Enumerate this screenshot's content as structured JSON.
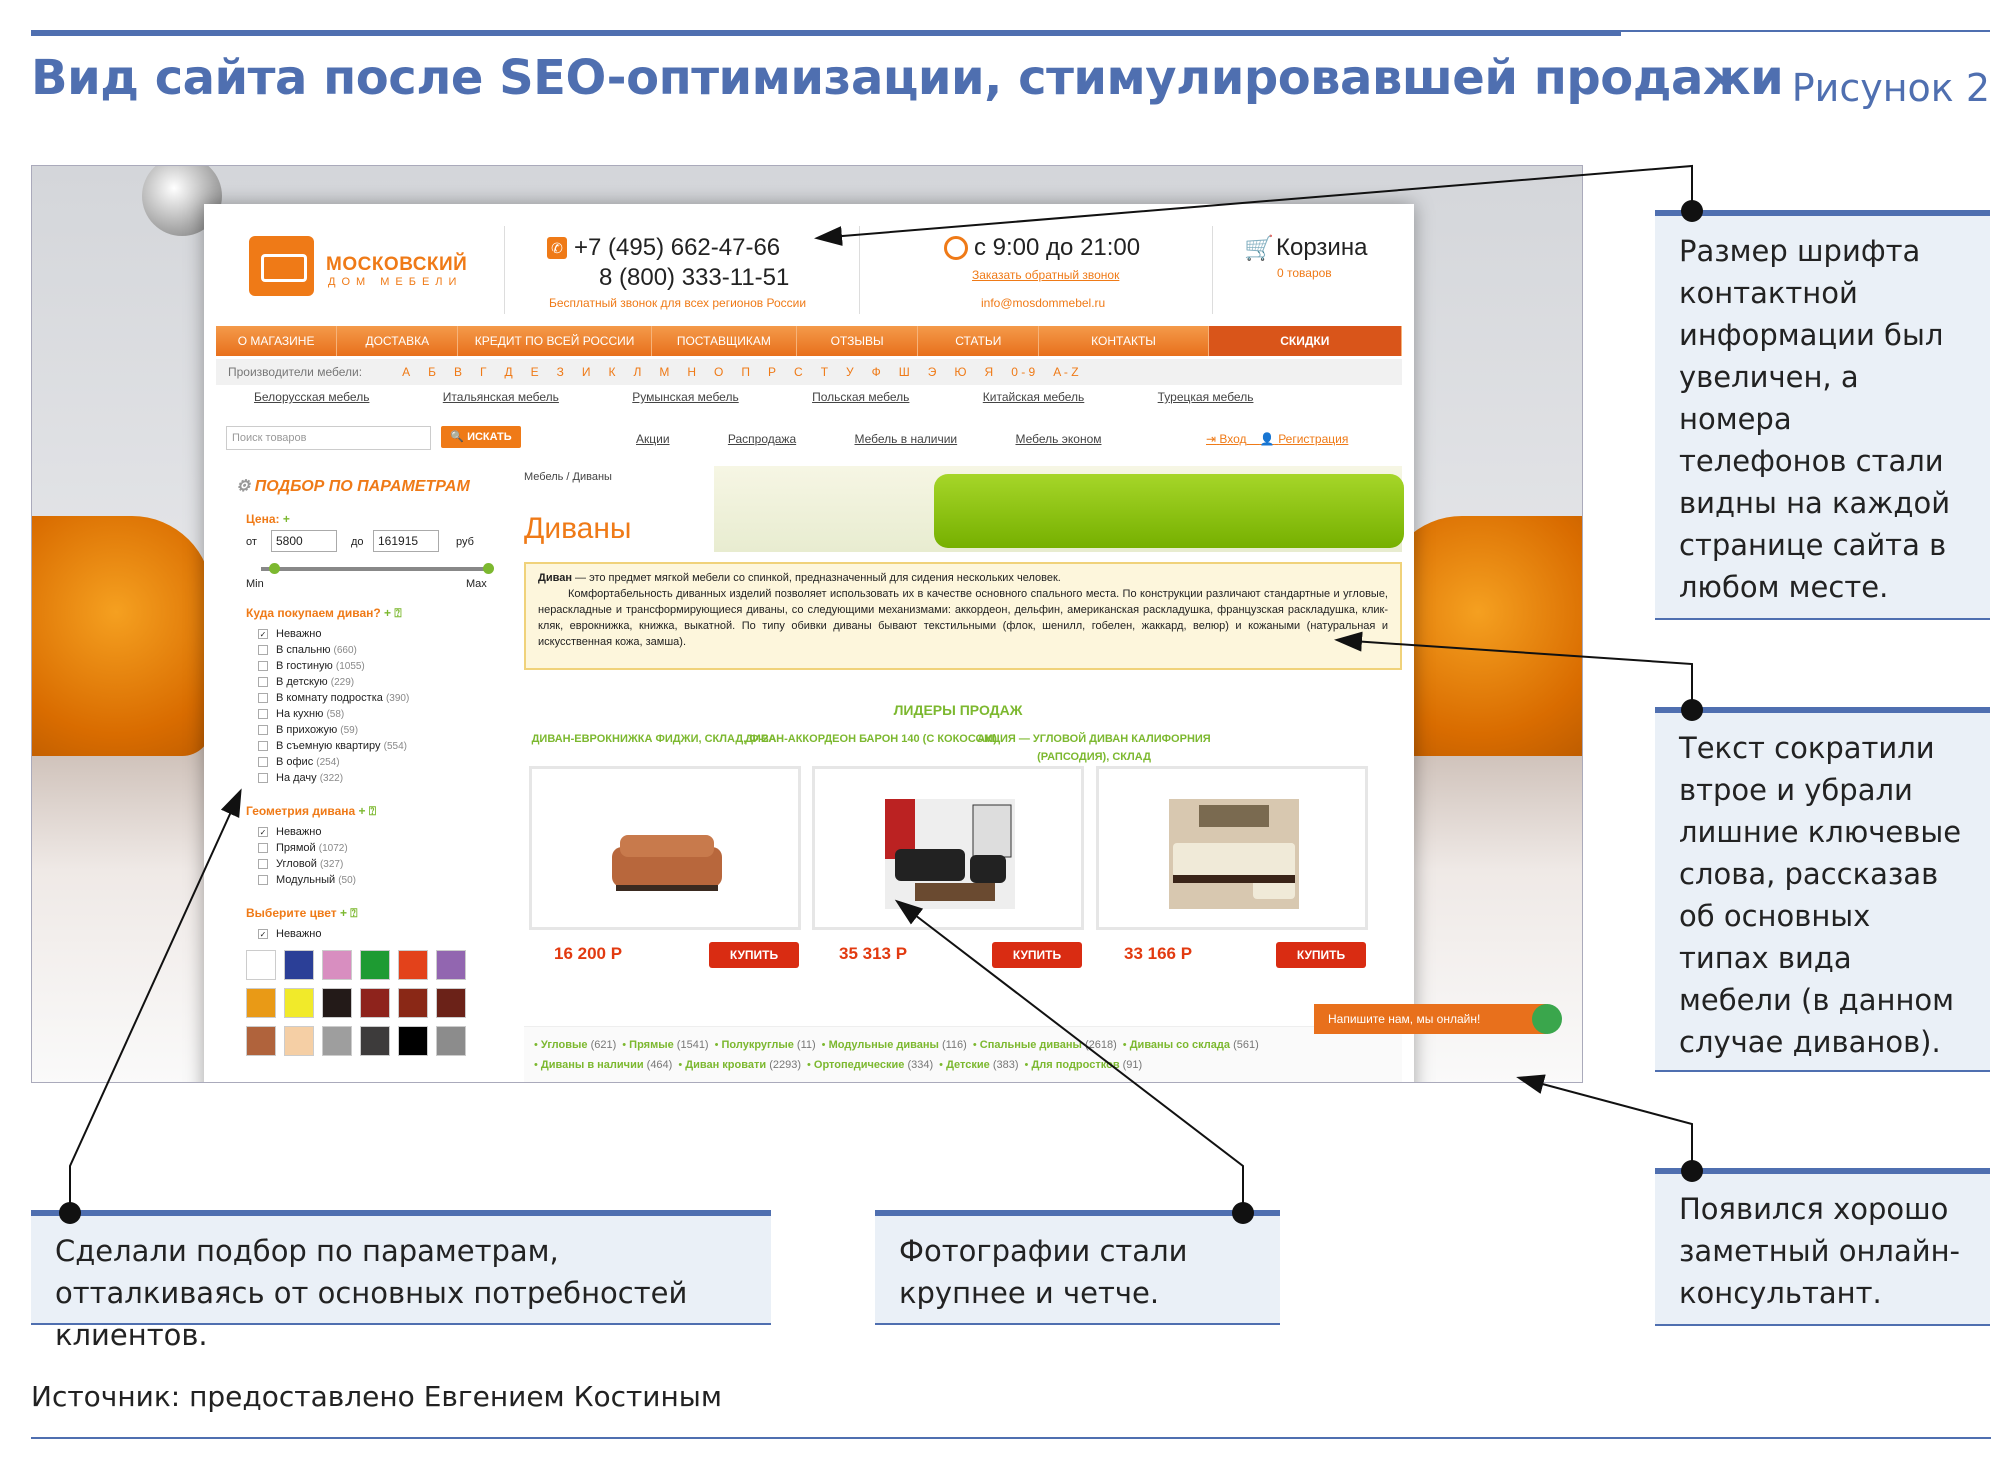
{
  "header": {
    "title": "Вид сайта после SEO-оптимизации, стимулировавшей продажи",
    "figure": "Рисунок 2"
  },
  "site": {
    "logo": {
      "name": "МОСКОВСКИЙ",
      "sub": "ДОМ МЕБЕЛИ"
    },
    "phone1": "+7 (495) 662-47-66",
    "phone2": "8 (800) 333-11-51",
    "free_call": "Бесплатный звонок для всех регионов России",
    "hours": "с 9:00 до 21:00",
    "callback": "Заказать обратный звонок",
    "email": "info@mosdommebel.ru",
    "cart": "Корзина",
    "cart_count": "0 товаров",
    "nav": [
      "О МАГАЗИНЕ",
      "ДОСТАВКА",
      "КРЕДИТ ПО ВСЕЙ РОССИИ",
      "ПОСТАВЩИКАМ",
      "ОТЗЫВЫ",
      "СТАТЬИ",
      "КОНТАКТЫ",
      "СКИДКИ"
    ],
    "alpha_label": "Производители мебели:",
    "alpha": [
      "А",
      "Б",
      "В",
      "Г",
      "Д",
      "Е",
      "З",
      "И",
      "К",
      "Л",
      "М",
      "Н",
      "О",
      "П",
      "Р",
      "С",
      "Т",
      "У",
      "Ф",
      "Ш",
      "Э",
      "Ю",
      "Я",
      "0 - 9",
      "A - Z"
    ],
    "countries": [
      "Белорусская мебель",
      "Итальянская мебель",
      "Румынская мебель",
      "Польская мебель",
      "Китайская мебель",
      "Турецкая мебель"
    ],
    "search_placeholder": "Поиск товаров",
    "search_button": "ИСКАТЬ",
    "links": [
      "Акции",
      "Распродажа",
      "Мебель в наличии",
      "Мебель эконом"
    ],
    "login": "Вход",
    "register": "Регистрация",
    "sidebar": {
      "title": "ПОДБОР ПО ПАРАМЕТРАМ",
      "price_label": "Цена:",
      "from": "от",
      "from_value": "5800",
      "to": "до",
      "to_value": "161915",
      "currency": "руб",
      "min": "Min",
      "max": "Max",
      "where_label": "Куда покупаем диван?",
      "where": [
        {
          "label": "Неважно",
          "count": "",
          "checked": true
        },
        {
          "label": "В спальню",
          "count": "(660)"
        },
        {
          "label": "В гостиную",
          "count": "(1055)"
        },
        {
          "label": "В детскую",
          "count": "(229)"
        },
        {
          "label": "В комнату подростка",
          "count": "(390)"
        },
        {
          "label": "На кухню",
          "count": "(58)"
        },
        {
          "label": "В прихожую",
          "count": "(59)"
        },
        {
          "label": "В съемную квартиру",
          "count": "(554)"
        },
        {
          "label": "В офис",
          "count": "(254)"
        },
        {
          "label": "На дачу",
          "count": "(322)"
        }
      ],
      "geom_label": "Геометрия дивана",
      "geom": [
        {
          "label": "Неважно",
          "count": "",
          "checked": true
        },
        {
          "label": "Прямой",
          "count": "(1072)"
        },
        {
          "label": "Угловой",
          "count": "(327)"
        },
        {
          "label": "Модульный",
          "count": "(50)"
        }
      ],
      "color_label": "Выберите цвет",
      "color_any": "Неважно",
      "colors": [
        "#ffffff",
        "#2b3f97",
        "#d88ec0",
        "#1e9b32",
        "#e3421b",
        "#9266b0",
        "#e99a16",
        "#f1ea2a",
        "#231a18",
        "#8e231c",
        "#8a2816",
        "#6b2218",
        "#b0633c",
        "#f5cfa5",
        "#9e9e9e",
        "#3d3b3b",
        "#000000",
        "#8c8c8c"
      ]
    },
    "breadcrumb": "Мебель  /  Диваны",
    "h1": "Диваны",
    "intro_bold": "Диван",
    "intro_1": " — это предмет мягкой мебели со спинкой, предназначенный для сидения нескольких человек.",
    "intro_2": "Комфортабельность диванных изделий позволяет использовать их в качестве основного спального места. По конструкции различают стандартные и угловые, нераскладные и трансформирующиеся диваны, со следующими механизмами: аккордеон, дельфин, американская раскладушка, французская раскладушка, клик-кляк, еврокнижка, книжка, выкатной. По типу обивки диваны бывают текстильными (флок, шенилл, гобелен, жаккард, велюр) и кожаными (натуральная и искусственная кожа, замша).",
    "leaders": "ЛИДЕРЫ ПРОДАЖ",
    "products": [
      {
        "title": "ДИВАН-ЕВРОКНИЖКА ФИДЖИ, СКЛАД, Ф-2А",
        "price": "16 200 Р",
        "buy": "КУПИТЬ"
      },
      {
        "title": "ДИВАН-АККОРДЕОН БАРОН 140 (С КОКОСОМ)",
        "price": "35 313 Р",
        "buy": "КУПИТЬ"
      },
      {
        "title": "АКЦИЯ — УГЛОВОЙ ДИВАН КАЛИФОРНИЯ (РАПСОДИЯ), СКЛАД",
        "price": "33 166 Р",
        "buy": "КУПИТЬ"
      }
    ],
    "tags_line1": [
      {
        "t": "Угловые",
        "c": "(621)"
      },
      {
        "t": "Прямые",
        "c": "(1541)"
      },
      {
        "t": "Полукруглые",
        "c": "(11)"
      },
      {
        "t": "Модульные диваны",
        "c": "(116)"
      },
      {
        "t": "Спальные диваны",
        "c": "(2618)"
      },
      {
        "t": "Диваны со склада",
        "c": "(561)"
      }
    ],
    "tags_line2": [
      {
        "t": "Диваны в наличии",
        "c": "(464)"
      },
      {
        "t": "Диван кровати",
        "c": "(2293)"
      },
      {
        "t": "Ортопедические",
        "c": "(334)"
      },
      {
        "t": "Детские",
        "c": "(383)"
      },
      {
        "t": "Для подростков",
        "c": "(91)"
      }
    ],
    "chat": "Напишите нам, мы онлайн!"
  },
  "callouts": {
    "c1": "Размер шрифта контактной информации был увеличен, а номера телефонов стали видны на каждой странице сайта в любом месте.",
    "c2": "Текст сократили втрое и убрали лишние ключевые слова, рассказав об основных типах вида мебели (в данном случае диванов).",
    "c3": "Появился хорошо заметный онлайн-консультант.",
    "c4": "Сделали подбор по параметрам, отталкиваясь от основных потребностей клиентов.",
    "c5": "Фотографии стали крупнее и четче."
  },
  "source": "Источник: предоставлено Евгением Костиным"
}
